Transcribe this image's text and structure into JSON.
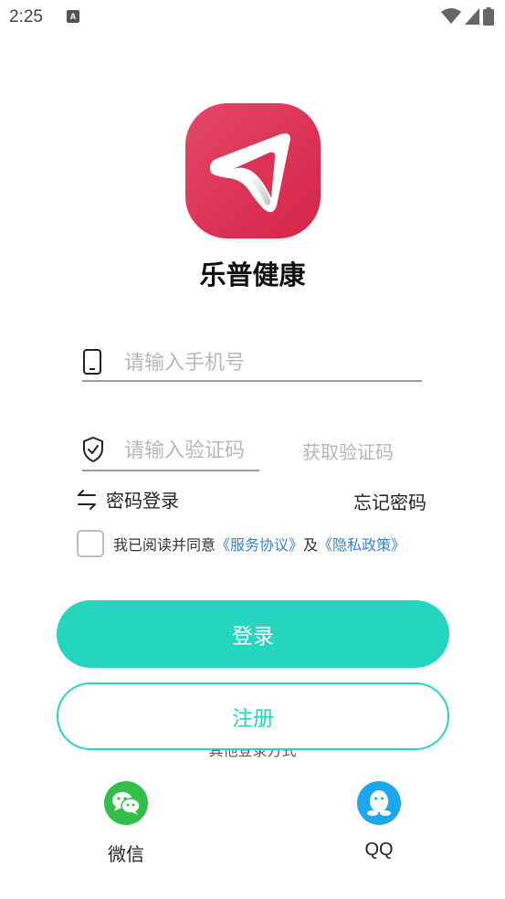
{
  "status_bar": {
    "time": "2:25",
    "notification_letter": "A",
    "icons": [
      "wifi-icon",
      "signal-icon",
      "battery-icon"
    ]
  },
  "app": {
    "name": "乐普健康",
    "logo_icon": "paper-plane-logo"
  },
  "phone": {
    "placeholder": "请输入手机号",
    "value": ""
  },
  "code": {
    "placeholder": "请输入验证码",
    "value": "",
    "get_code_label": "获取验证码"
  },
  "options": {
    "password_login": "密码登录",
    "forgot_password": "忘记密码"
  },
  "agreement": {
    "checked": false,
    "prefix": "我已阅读并同意",
    "service_link": "《服务协议》",
    "and": "及",
    "privacy_link": "《隐私政策》"
  },
  "buttons": {
    "login": "登录",
    "register": "注册"
  },
  "other_login": {
    "title": "其他登录方式",
    "wechat": "微信",
    "qq": "QQ"
  },
  "colors": {
    "accent": "#26d5c0",
    "logo": "#dc3355",
    "link": "#3b82c9",
    "wechat": "#32be48",
    "qq": "#1ea6ea"
  }
}
